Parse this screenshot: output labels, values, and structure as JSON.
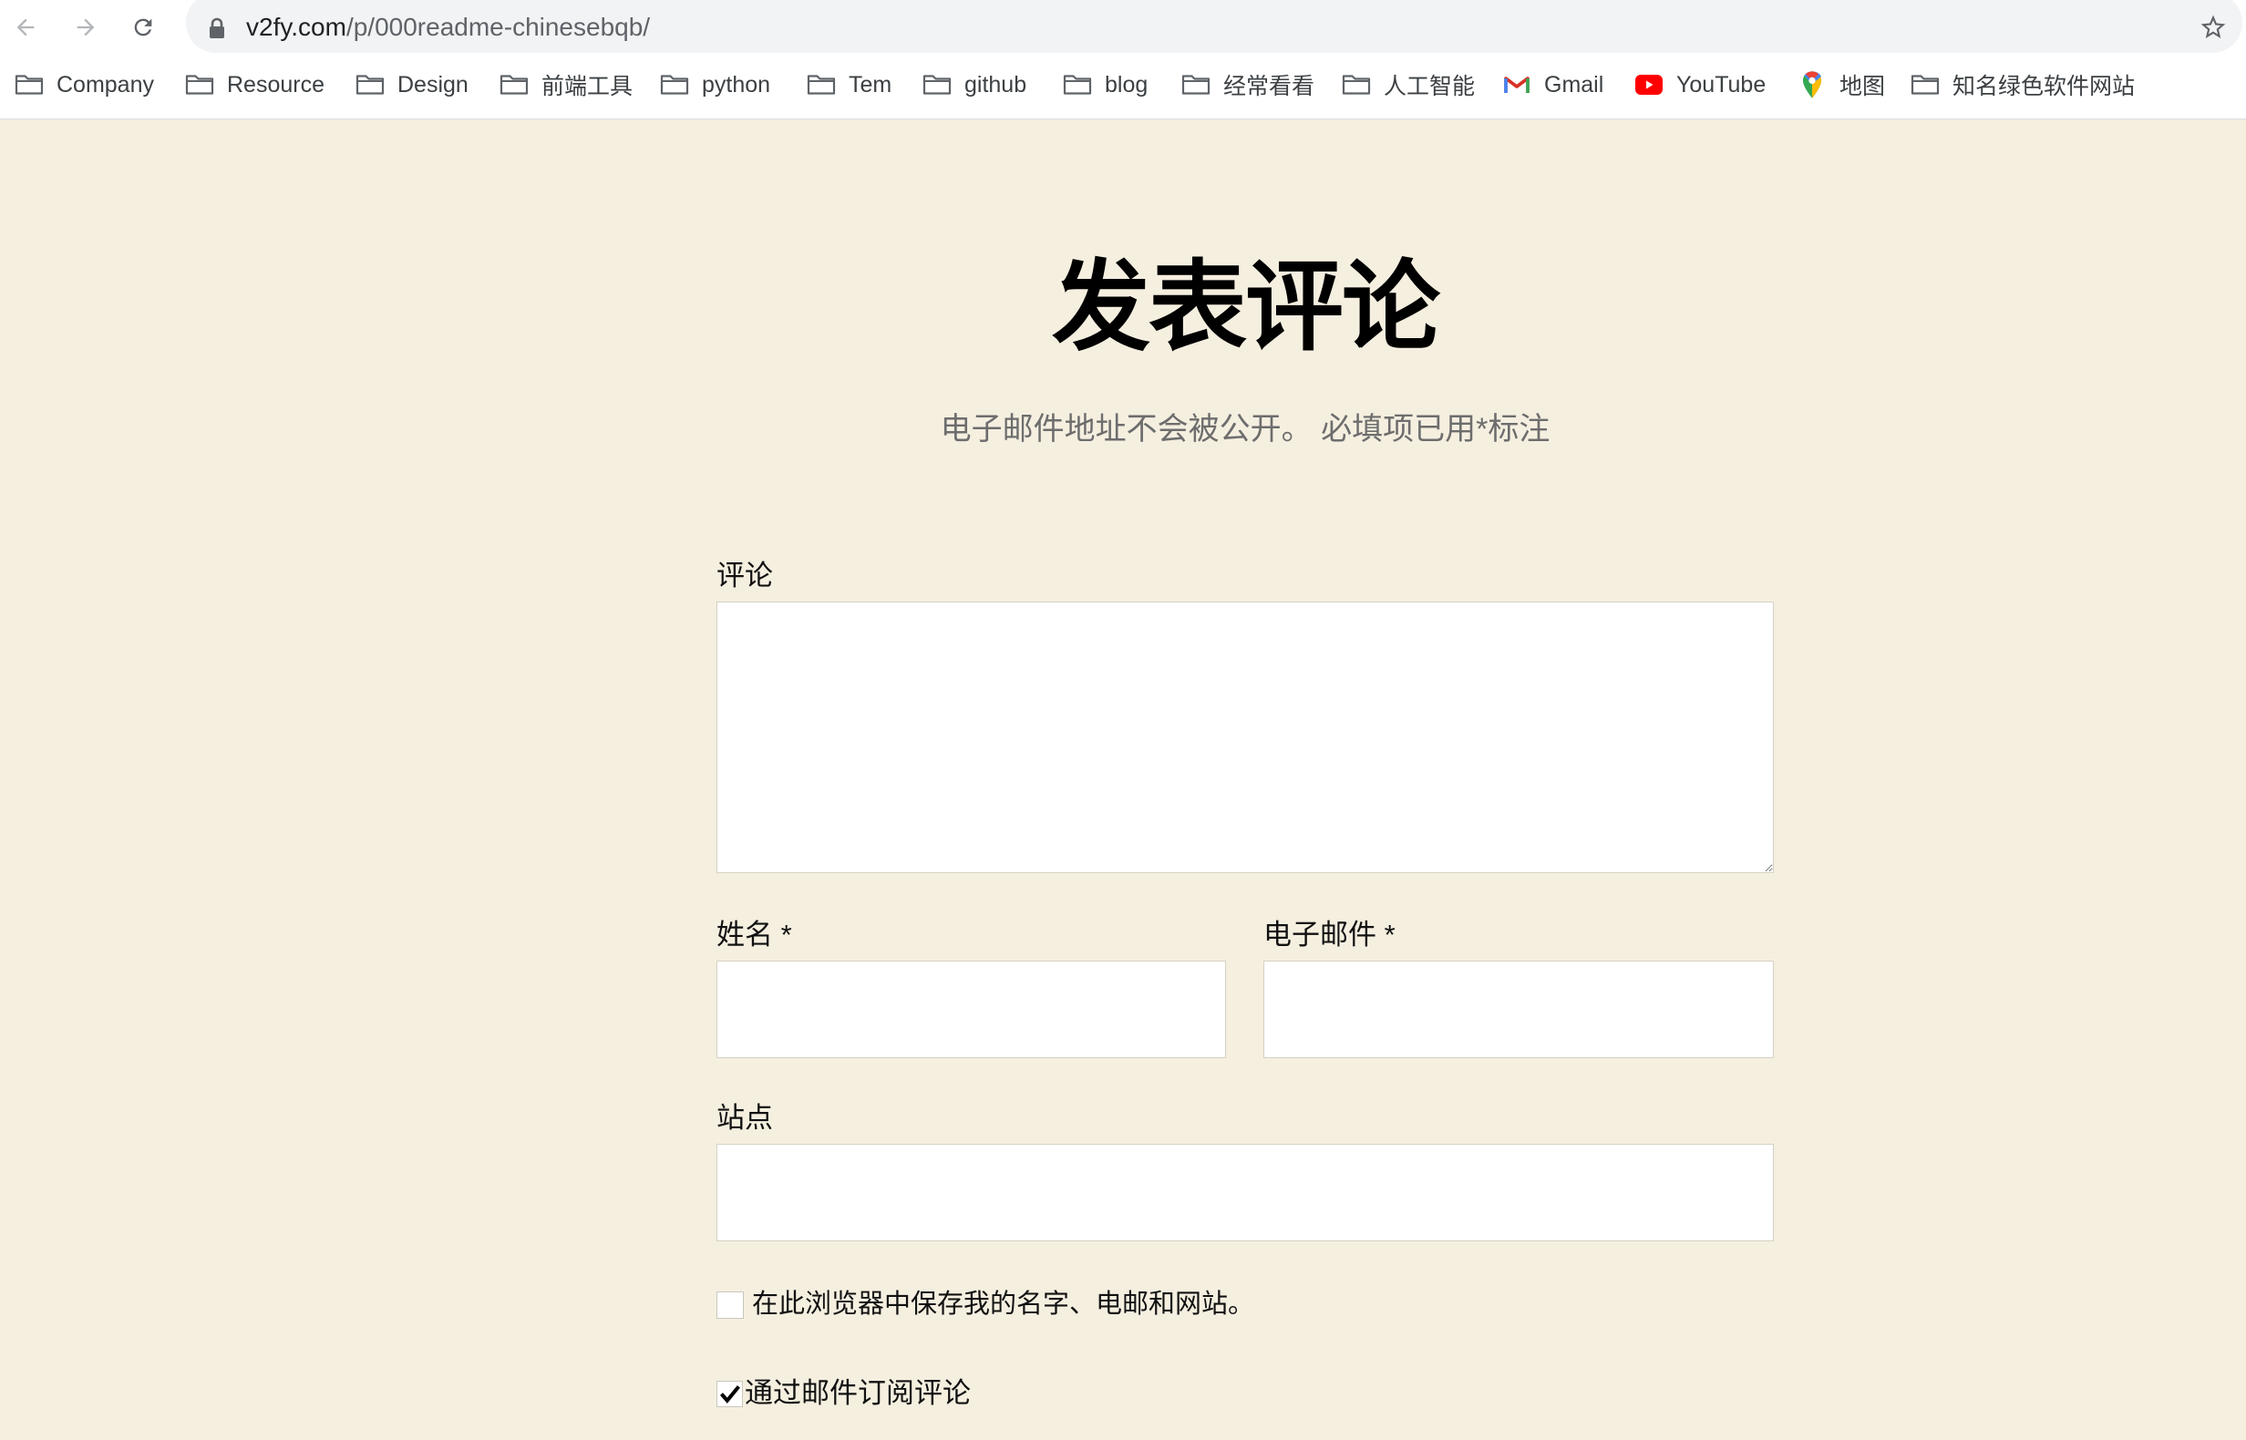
{
  "browser": {
    "back_icon": "arrow-left-icon",
    "forward_icon": "arrow-right-icon",
    "reload_icon": "reload-icon",
    "lock_icon": "lock-icon",
    "url_host": "v2fy.com",
    "url_path": "/p/000readme-chinesebqb/",
    "bookmark_star_icon": "star-icon"
  },
  "bookmarks": [
    {
      "label": "Company",
      "icon": "folder-icon"
    },
    {
      "label": "Resource",
      "icon": "folder-icon"
    },
    {
      "label": "Design",
      "icon": "folder-icon"
    },
    {
      "label": "前端工具",
      "icon": "folder-icon"
    },
    {
      "label": "python",
      "icon": "folder-icon"
    },
    {
      "label": "Tem",
      "icon": "folder-icon"
    },
    {
      "label": "github",
      "icon": "folder-icon"
    },
    {
      "label": "blog",
      "icon": "folder-icon"
    },
    {
      "label": "经常看看",
      "icon": "folder-icon"
    },
    {
      "label": "人工智能",
      "icon": "folder-icon"
    },
    {
      "label": "Gmail",
      "icon": "gmail-icon"
    },
    {
      "label": "YouTube",
      "icon": "youtube-icon"
    },
    {
      "label": "地图",
      "icon": "maps-pin-icon"
    },
    {
      "label": "知名绿色软件网站",
      "icon": "folder-icon"
    }
  ],
  "comment_form": {
    "title": "发表评论",
    "notes": "电子邮件地址不会被公开。 必填项已用*标注",
    "comment": {
      "label": "评论",
      "value": ""
    },
    "author": {
      "label": "姓名 *",
      "value": ""
    },
    "email": {
      "label": "电子邮件 *",
      "value": ""
    },
    "url": {
      "label": "站点",
      "value": ""
    },
    "cookies_consent": {
      "label": "在此浏览器中保存我的名字、电邮和网站。",
      "checked": false
    },
    "subscribe": {
      "label": "通过邮件订阅评论",
      "checked": true
    }
  },
  "colors": {
    "page_background": "#f5efe0",
    "field_background": "#ffffff",
    "field_border": "#d6d1c4",
    "notes_text": "#6d6d6d"
  }
}
